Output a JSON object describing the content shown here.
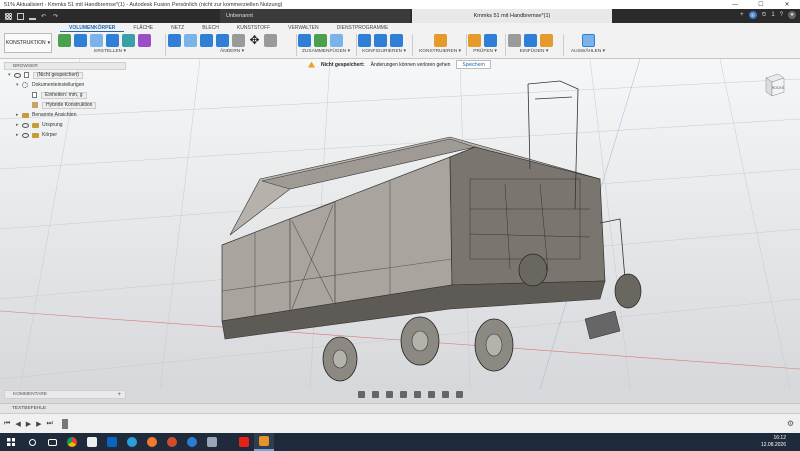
{
  "window": {
    "title": "51% Aktualisiert - Kmmks 51 mit Handbremse*(1) - Autodesk Fusion Persönlich (nicht zur kommerziellen Nutzung)",
    "min": "—",
    "max": "☐",
    "close": "✕"
  },
  "doc_tabs": [
    {
      "label": "Unbenannt"
    },
    {
      "label": "Kmmks 51 mit Handbremse*(1)"
    }
  ],
  "tabstrip_right": {
    "count": "1",
    "add": "+"
  },
  "toolbar": {
    "workspace": "KONSTRUKTION",
    "tabs": [
      "VOLUMENKÖRPER",
      "FLÄCHE",
      "NETZ",
      "BLECH",
      "KUNSTSTOFF",
      "VERWALTEN",
      "DIENSTPROGRAMME"
    ],
    "groups": [
      {
        "label": "ERSTELLEN ▾"
      },
      {
        "label": "ÄNDERN ▾"
      },
      {
        "label": "ZUSAMMENFÜGEN ▾"
      },
      {
        "label": "KONFIGURIEREN ▾"
      },
      {
        "label": "KONSTRUIEREN ▾"
      },
      {
        "label": "PRÜFEN ▾"
      },
      {
        "label": "EINFÜGEN ▾"
      },
      {
        "label": "AUSWÄHLEN ▾"
      }
    ]
  },
  "notice": {
    "label": "Nicht gespeichert:",
    "message": "Änderungen können verloren gehen",
    "save": "Speichern"
  },
  "browser": {
    "title": "BROWSER",
    "root": "(Nicht gespeichert)",
    "items": [
      {
        "label": "Dokumenteinstellungen"
      },
      {
        "label": "Einheiten: mm, g"
      },
      {
        "label": "Hybride Konstruktion"
      },
      {
        "label": "Benannte Ansichten"
      },
      {
        "label": "Ursprung"
      },
      {
        "label": "Körper"
      }
    ]
  },
  "viewcube": {
    "face": "RÜCKS"
  },
  "comments": {
    "title": "KOMMENTARE",
    "add": "+"
  },
  "text_commands": "TEXTBEFEHLE",
  "taskbar": {
    "time": "16:12",
    "date": "12.08.2026"
  },
  "colors": {
    "accent": "#1e64b4",
    "taskbar": "#1f2b3a",
    "warning": "#f0a020"
  }
}
